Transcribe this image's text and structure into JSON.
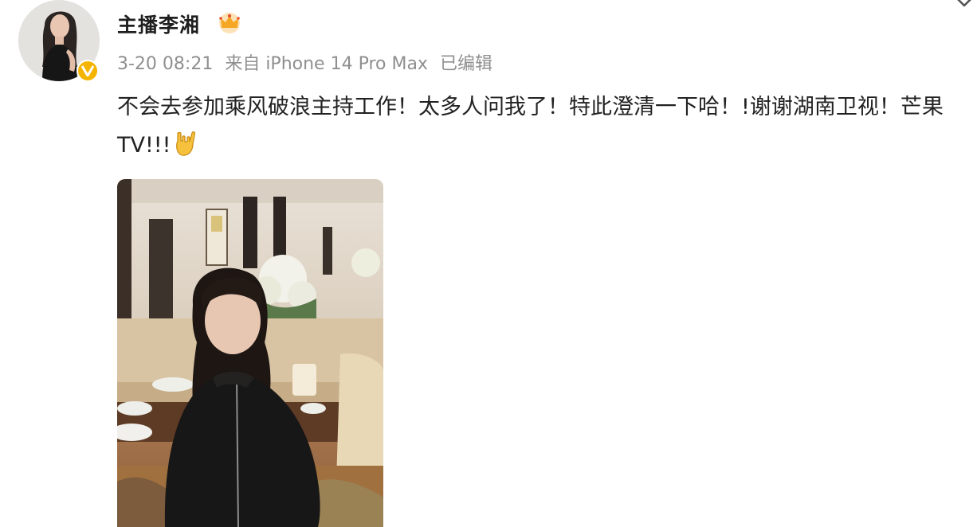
{
  "post": {
    "username": "主播李湘",
    "timestamp": "3-20 08:21",
    "source": "来自 iPhone 14 Pro Max",
    "edited": "已编辑",
    "text": "不会去参加乘风破浪主持工作！太多人问我了！特此澄清一下哈！!谢谢湖南卫视！芒果TV!!!",
    "icons": {
      "avatar": "avatar",
      "verified_badge": "verified-v-icon",
      "member_crown": "crown-icon",
      "menu": "chevron-down-icon",
      "emoji": "rock-hand-emoji-icon"
    },
    "colors": {
      "meta_text": "#8f8f8f",
      "verified": "#f4b400",
      "crown": "#f5a623"
    }
  }
}
